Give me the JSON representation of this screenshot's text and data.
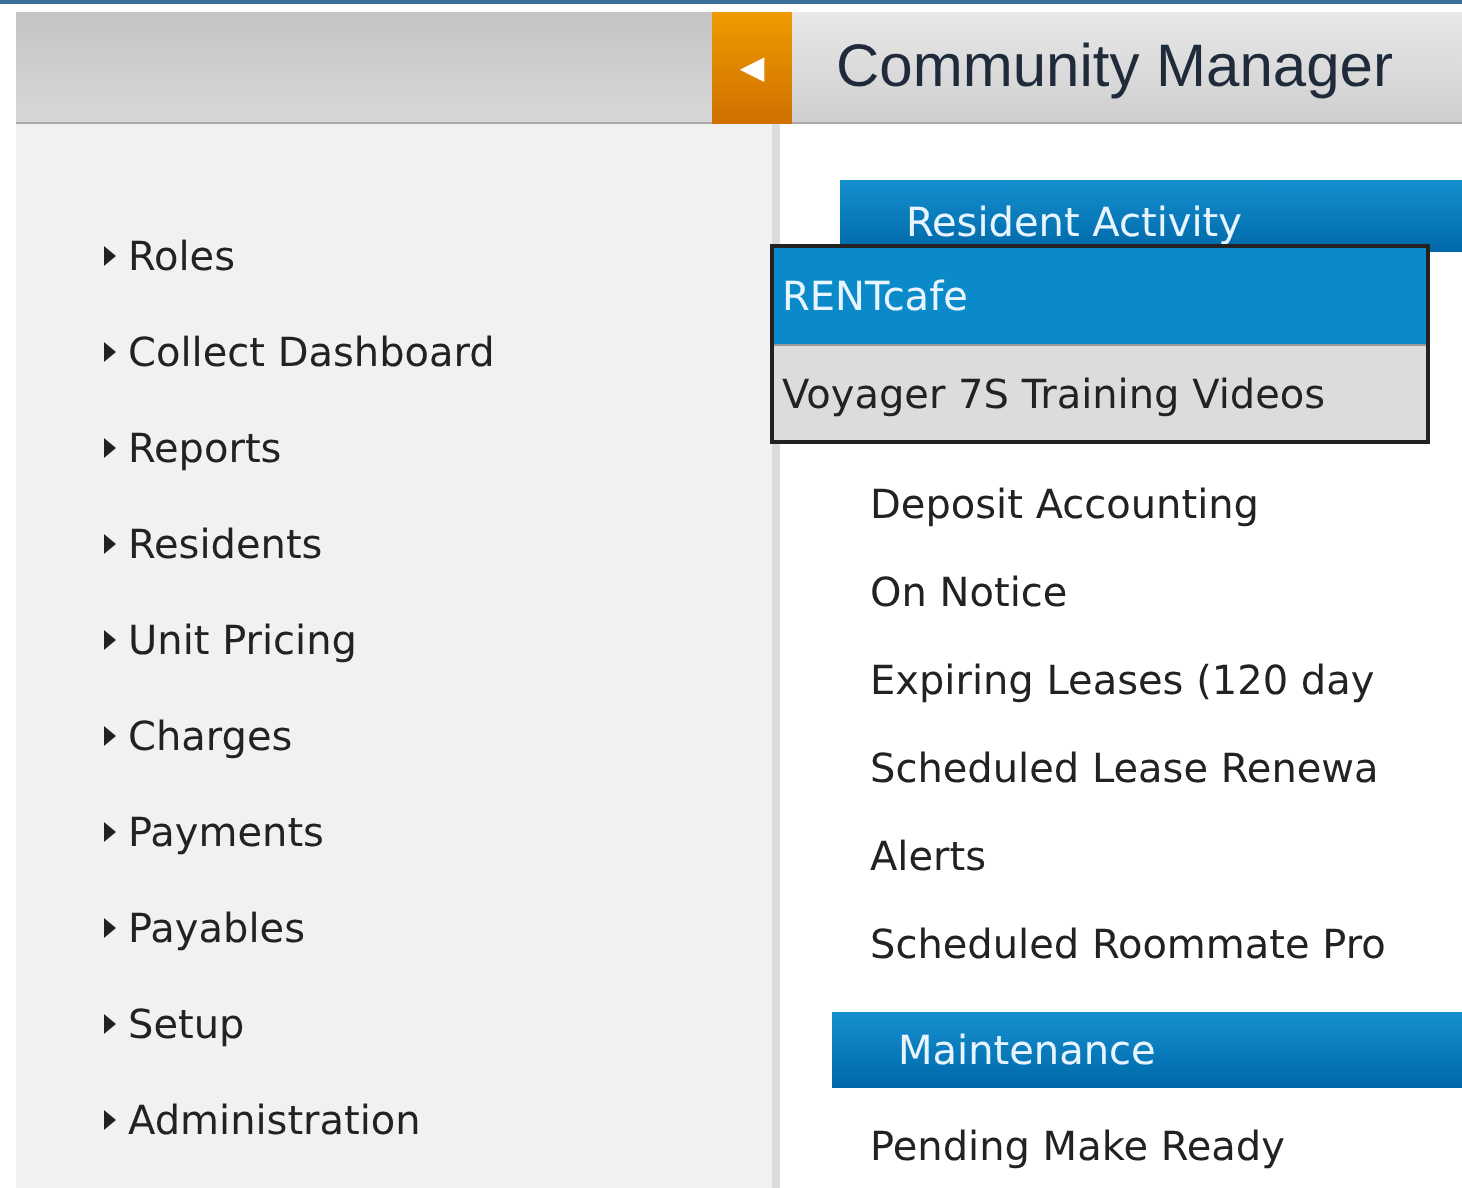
{
  "header": {
    "collapse_glyph": "◀",
    "title": "Community Manager"
  },
  "sidebar": {
    "items": [
      {
        "label": "Roles"
      },
      {
        "label": "Collect Dashboard"
      },
      {
        "label": "Reports"
      },
      {
        "label": "Residents"
      },
      {
        "label": "Unit Pricing"
      },
      {
        "label": "Charges"
      },
      {
        "label": "Payments"
      },
      {
        "label": "Payables"
      },
      {
        "label": "Setup"
      },
      {
        "label": "Administration"
      }
    ]
  },
  "sections": [
    {
      "title": "Resident Activity",
      "links": [
        "Deposit Accounting",
        "On Notice",
        "Expiring Leases (120 day",
        "Scheduled Lease Renewa",
        "Alerts",
        "Scheduled Roommate Pro"
      ]
    },
    {
      "title": "Maintenance",
      "links": [
        "Pending Make Ready"
      ]
    }
  ],
  "dropdown": {
    "items": [
      {
        "label": "RENTcafe",
        "selected": true
      },
      {
        "label": "Voyager 7S Training Videos",
        "selected": false
      }
    ]
  }
}
